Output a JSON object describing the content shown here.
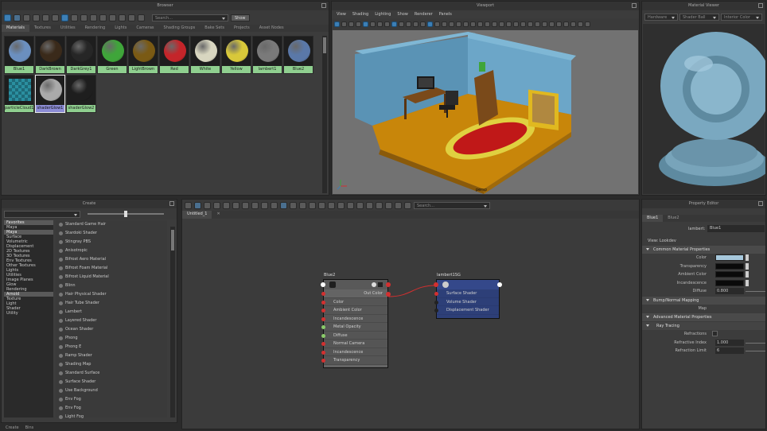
{
  "browser": {
    "title": "Browser",
    "search_placeholder": "Search...",
    "show_label": "Show",
    "tabs": [
      "Materials",
      "Textures",
      "Utilities",
      "Rendering",
      "Lights",
      "Cameras",
      "Shading Groups",
      "Bake Sets",
      "Projects",
      "Asset Nodes"
    ],
    "swatches": [
      {
        "label": "Blue1",
        "color": "#6b8fbf"
      },
      {
        "label": "DarkBrown",
        "color": "#3a2a1a"
      },
      {
        "label": "DarkGrey1",
        "color": "#262626"
      },
      {
        "label": "Green",
        "color": "#3fa53a"
      },
      {
        "label": "LightBrown",
        "color": "#7a5a14"
      },
      {
        "label": "Red",
        "color": "#c4252a"
      },
      {
        "label": "White",
        "color": "#d8d6c0"
      },
      {
        "label": "Yellow",
        "color": "#d8c83a"
      },
      {
        "label": "lambert1",
        "color": "#7a7a7a"
      },
      {
        "label": "Blue2",
        "color": "#5a78a8"
      },
      {
        "label": "particleCloud1",
        "color": "#2a8fa0"
      },
      {
        "label": "shaderGlow1",
        "color": "#aaaaaa"
      },
      {
        "label": "shaderGlow2",
        "color": "#1e1e1e"
      }
    ]
  },
  "viewport": {
    "title": "Viewport",
    "menu": [
      "View",
      "Shading",
      "Lighting",
      "Show",
      "Renderer",
      "Panels"
    ],
    "camera_label": "persp"
  },
  "material_viewer": {
    "title": "Material Viewer",
    "renderer": "Hardware",
    "shape": "Shader Ball",
    "shader": "Interior Color"
  },
  "create": {
    "title": "Create",
    "categories": [
      {
        "label": "Favorites",
        "hdr": true
      },
      {
        "label": "Maya",
        "hdr": false
      },
      {
        "label": "Maya",
        "hdr": true
      },
      {
        "label": "Surface",
        "hdr": false
      },
      {
        "label": "Volumetric",
        "hdr": false
      },
      {
        "label": "Displacement",
        "hdr": false
      },
      {
        "label": "2D Textures",
        "hdr": false
      },
      {
        "label": "3D Textures",
        "hdr": false
      },
      {
        "label": "Env Textures",
        "hdr": false
      },
      {
        "label": "Other Textures",
        "hdr": false
      },
      {
        "label": "Lights",
        "hdr": false
      },
      {
        "label": "Utilities",
        "hdr": false
      },
      {
        "label": "Image Planes",
        "hdr": false
      },
      {
        "label": "Glow",
        "hdr": false
      },
      {
        "label": "Rendering",
        "hdr": false
      },
      {
        "label": "Arnold",
        "hdr": true
      },
      {
        "label": "Texture",
        "hdr": false
      },
      {
        "label": "Light",
        "hdr": false
      },
      {
        "label": "Shader",
        "hdr": false
      },
      {
        "label": "Utility",
        "hdr": false
      }
    ],
    "nodes": [
      "Standard Game Hair",
      "Stardoki Shader",
      "Stingray PBS",
      "Anisotropic",
      "Bifrost Aero Material",
      "Bifrost Foam Material",
      "Bifrost Liquid Material",
      "Blinn",
      "Hair Physical Shader",
      "Hair Tube Shader",
      "Lambert",
      "Layered Shader",
      "Ocean Shader",
      "Phong",
      "Phong E",
      "Ramp Shader",
      "Shading Map",
      "Standard Surface",
      "Surface Shader",
      "Use Background",
      "Env Fog",
      "Env Fog",
      "Light Fog"
    ]
  },
  "node_editor": {
    "search_placeholder": "Search...",
    "tab_label": "Untitled_1",
    "node1": {
      "name": "Blue2",
      "out": "Out Color",
      "attrs": [
        "Color",
        "Ambient Color",
        "Incandescence",
        "Metal Opacity",
        "Diffuse",
        "Normal Camera",
        "Incandescence",
        "Transparency"
      ]
    },
    "node2": {
      "name": "lambert1SG",
      "attrs": [
        "Surface Shader",
        "Volume Shader",
        "Displacement Shader"
      ]
    }
  },
  "attribute_editor": {
    "title": "Property Editor",
    "tabs": [
      "Blue1",
      "Blue2"
    ],
    "type_label": "lambert:",
    "type_value": "Blue1",
    "view_label": "View: Lookdev",
    "section_common": "Common Material Properties",
    "rows_common": [
      {
        "label": "Color",
        "type": "swatch",
        "color": "#a7c8dc"
      },
      {
        "label": "Transparency",
        "type": "swatch",
        "color": "#0a0a0a"
      },
      {
        "label": "Ambient Color",
        "type": "swatch",
        "color": "#0a0a0a"
      },
      {
        "label": "Incandescence",
        "type": "swatch",
        "color": "#0a0a0a"
      },
      {
        "label": "Diffuse",
        "type": "field",
        "value": "0.800"
      }
    ],
    "section_bump": "Bump/Normal Mapping",
    "map_label": "Map",
    "section_advanced": "Advanced Material Properties",
    "section_ray": "Ray Tracing",
    "rows_ray": [
      {
        "label": "Refractions",
        "type": "check"
      },
      {
        "label": "Refractive Index",
        "type": "field",
        "value": "1.000"
      },
      {
        "label": "Refraction Limit",
        "type": "field",
        "value": "6"
      }
    ]
  },
  "bottom_tabs": [
    "Create",
    "Bins"
  ]
}
